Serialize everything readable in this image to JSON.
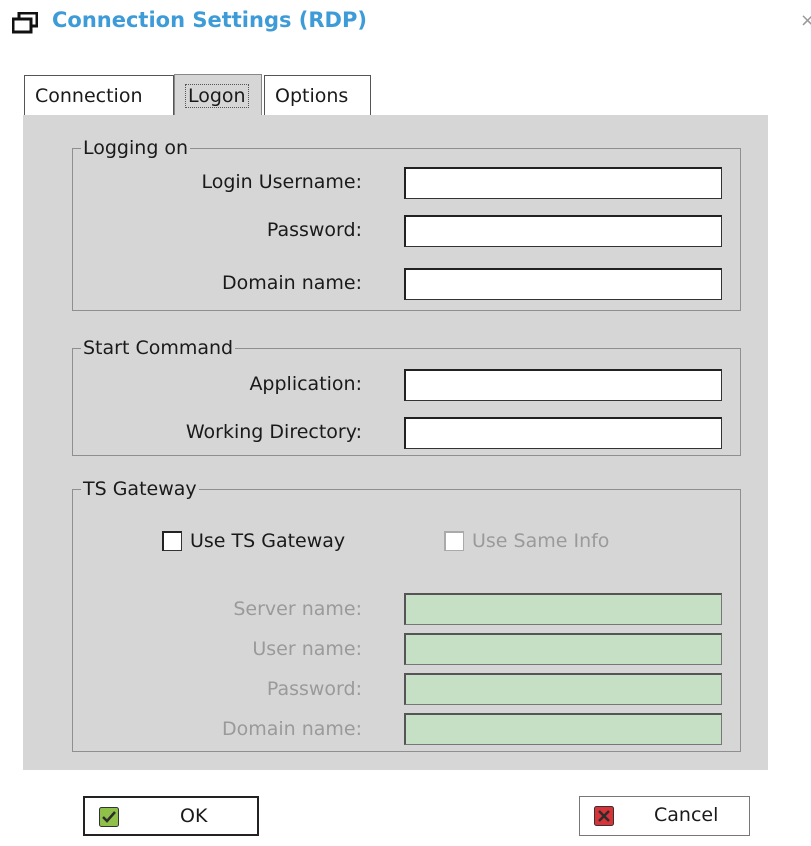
{
  "window": {
    "title": "Connection Settings (RDP)",
    "close_glyph": "×"
  },
  "tabs": [
    {
      "label": "Connection",
      "mnemonic": "t",
      "active": false
    },
    {
      "label": "Logon",
      "mnemonic": "L",
      "active": true
    },
    {
      "label": "Options",
      "mnemonic": "i",
      "active": false
    }
  ],
  "logging_on": {
    "legend": "Logging on",
    "username_label": "Login Username:",
    "username_value": "",
    "password_label": "Password:",
    "password_value": "",
    "domain_label": "Domain name:",
    "domain_value": ""
  },
  "start_command": {
    "legend": "Start Command",
    "application_label": "Application:",
    "application_value": "",
    "working_dir_label": "Working Directory:",
    "working_dir_value": ""
  },
  "ts_gateway": {
    "legend": "TS Gateway",
    "use_gateway_label": "Use TS Gateway",
    "use_gateway_checked": false,
    "use_same_info_label": "Use Same Info",
    "use_same_info_checked": false,
    "server_label": "Server name:",
    "user_label": "User name:",
    "password_label": "Password:",
    "domain_label": "Domain name:"
  },
  "buttons": {
    "ok_label": "OK",
    "cancel_label": "Cancel"
  },
  "colors": {
    "title": "#3d9bd8",
    "panel_bg": "#d6d6d6",
    "disabled_input": "#c6e0c6",
    "ok_icon": "#8fc04a",
    "cancel_icon": "#d9333a"
  },
  "icons": {
    "window": "window-restore-icon",
    "ok": "check-icon",
    "cancel": "x-icon"
  }
}
